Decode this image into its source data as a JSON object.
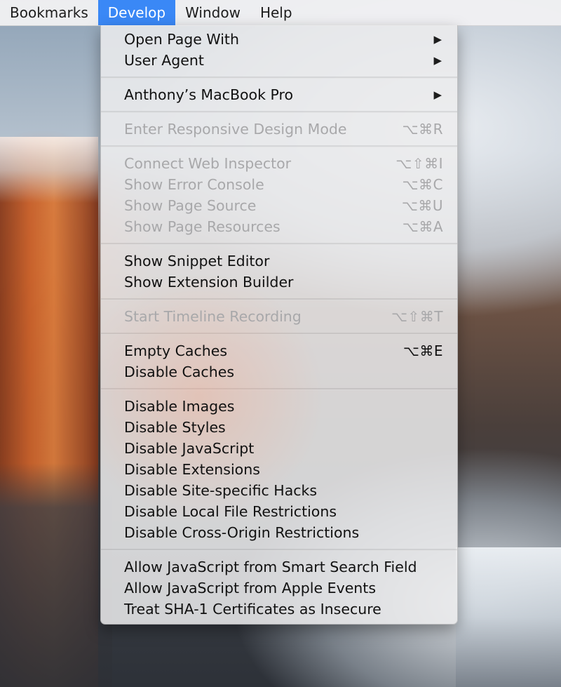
{
  "menubar": {
    "items": [
      {
        "label": "Bookmarks"
      },
      {
        "label": "Develop"
      },
      {
        "label": "Window"
      },
      {
        "label": "Help"
      }
    ]
  },
  "develop_menu": {
    "groups": [
      [
        {
          "label": "Open Page With",
          "shortcut": "",
          "submenu_indicator": "▶",
          "enabled": true
        },
        {
          "label": "User Agent",
          "shortcut": "",
          "submenu_indicator": "▶",
          "enabled": true
        }
      ],
      [
        {
          "label": "Anthony’s MacBook Pro",
          "shortcut": "",
          "submenu_indicator": "▶",
          "enabled": true
        }
      ],
      [
        {
          "label": "Enter Responsive Design Mode",
          "shortcut": "⌥⌘R",
          "enabled": false
        }
      ],
      [
        {
          "label": "Connect Web Inspector",
          "shortcut": "⌥⇧⌘I",
          "enabled": false
        },
        {
          "label": "Show Error Console",
          "shortcut": "⌥⌘C",
          "enabled": false
        },
        {
          "label": "Show Page Source",
          "shortcut": "⌥⌘U",
          "enabled": false
        },
        {
          "label": "Show Page Resources",
          "shortcut": "⌥⌘A",
          "enabled": false
        }
      ],
      [
        {
          "label": "Show Snippet Editor",
          "shortcut": "",
          "enabled": true
        },
        {
          "label": "Show Extension Builder",
          "shortcut": "",
          "enabled": true
        }
      ],
      [
        {
          "label": "Start Timeline Recording",
          "shortcut": "⌥⇧⌘T",
          "enabled": false
        }
      ],
      [
        {
          "label": "Empty Caches",
          "shortcut": "⌥⌘E",
          "enabled": true
        },
        {
          "label": "Disable Caches",
          "shortcut": "",
          "enabled": true
        }
      ],
      [
        {
          "label": "Disable Images",
          "shortcut": "",
          "enabled": true
        },
        {
          "label": "Disable Styles",
          "shortcut": "",
          "enabled": true
        },
        {
          "label": "Disable JavaScript",
          "shortcut": "",
          "enabled": true
        },
        {
          "label": "Disable Extensions",
          "shortcut": "",
          "enabled": true
        },
        {
          "label": "Disable Site-specific Hacks",
          "shortcut": "",
          "enabled": true
        },
        {
          "label": "Disable Local File Restrictions",
          "shortcut": "",
          "enabled": true
        },
        {
          "label": "Disable Cross-Origin Restrictions",
          "shortcut": "",
          "enabled": true
        }
      ],
      [
        {
          "label": "Allow JavaScript from Smart Search Field",
          "shortcut": "",
          "enabled": true
        },
        {
          "label": "Allow JavaScript from Apple Events",
          "shortcut": "",
          "enabled": true
        },
        {
          "label": "Treat SHA-1 Certificates as Insecure",
          "shortcut": "",
          "enabled": true
        }
      ]
    ]
  },
  "colors": {
    "menubar_active": "#3a88f6",
    "enabled_text": "#111111",
    "disabled_text": "#a8a8aa"
  }
}
